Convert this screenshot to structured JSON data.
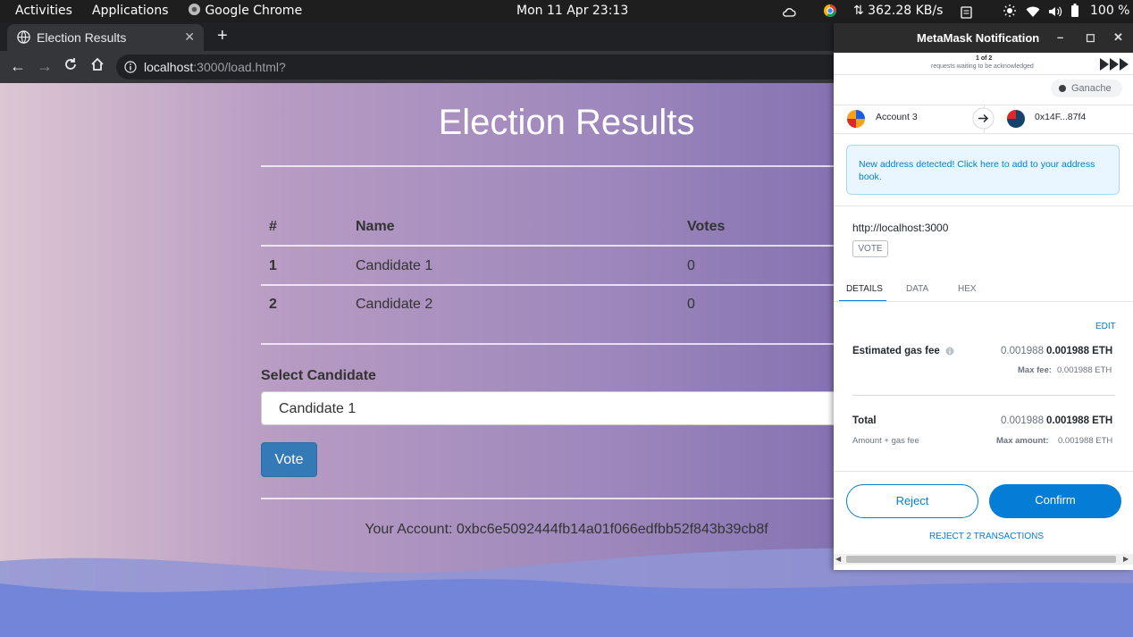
{
  "system": {
    "activities": "Activities",
    "applications": "Applications",
    "app_name": "Google Chrome",
    "datetime": "Mon 11 Apr  23:13",
    "network_speed": "⇅ 362.28 KB/s",
    "battery": "100 %"
  },
  "browser": {
    "tab_title": "Election Results",
    "url_host": "localhost",
    "url_rest": ":3000/load.html?"
  },
  "page": {
    "title": "Election Results",
    "table": {
      "headers": [
        "#",
        "Name",
        "Votes"
      ],
      "rows": [
        {
          "id": "1",
          "name": "Candidate 1",
          "votes": "0"
        },
        {
          "id": "2",
          "name": "Candidate 2",
          "votes": "0"
        }
      ]
    },
    "select_label": "Select Candidate",
    "selected_candidate": "Candidate 1",
    "vote_button": "Vote",
    "account": "Your Account: 0xbc6e5092444fb14a01f066edfbb52f843b39cb8f"
  },
  "metamask": {
    "window_title": "MetaMask Notification",
    "queue_count": "1 of 2",
    "queue_text": "requests waiting to be acknowledged",
    "network": "Ganache",
    "from_account": "Account 3",
    "to_address": "0x14F...87f4",
    "notice": "New address detected! Click here to add to your address book.",
    "origin": "http://localhost:3000",
    "method": "VOTE",
    "tabs": [
      "DETAILS",
      "DATA",
      "HEX"
    ],
    "edit": "EDIT",
    "gas_label": "Estimated gas fee",
    "gas_value": "0.001988",
    "gas_value_eth": "0.001988 ETH",
    "max_fee_label": "Max fee:",
    "max_fee_value": "0.001988 ETH",
    "total_label": "Total",
    "total_value": "0.001988",
    "total_value_eth": "0.001988 ETH",
    "total_sub": "Amount + gas fee",
    "max_amount_label": "Max amount:",
    "max_amount_value": "0.001988 ETH",
    "reject": "Reject",
    "confirm": "Confirm",
    "reject_all": "REJECT 2 TRANSACTIONS"
  },
  "colors": {
    "metamask_blue": "#037dd6",
    "bootstrap_primary": "#337ab7"
  }
}
